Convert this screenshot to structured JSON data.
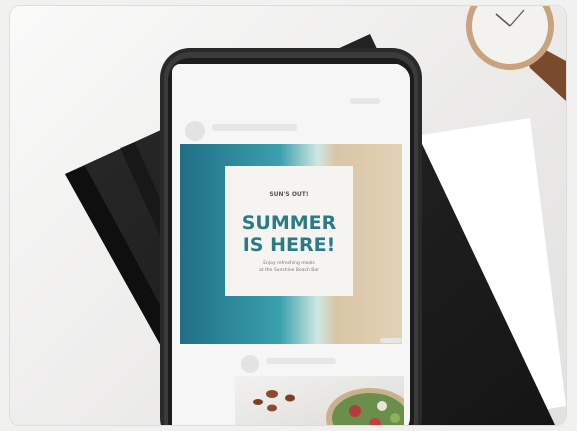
{
  "post": {
    "kicker": "SUN'S OUT!",
    "headline_line1": "SUMMER",
    "headline_line2": "IS HERE!",
    "caption_line1": "Enjoy refreshing meals",
    "caption_line2": "at the Sunshine Beach Bar"
  },
  "colors": {
    "background": "#f1f1f0",
    "notebook": "#1f1f1f",
    "phone_frame": "#2a2a2a",
    "ocean": "#2f8e9e",
    "sand": "#d9c6a6",
    "headline": "#2c7a86",
    "watch_strap": "#7a4a2c",
    "watch_case": "#c9a27e"
  },
  "icons": [
    "wristwatch",
    "notebook",
    "smartphone",
    "salad-bowl"
  ]
}
